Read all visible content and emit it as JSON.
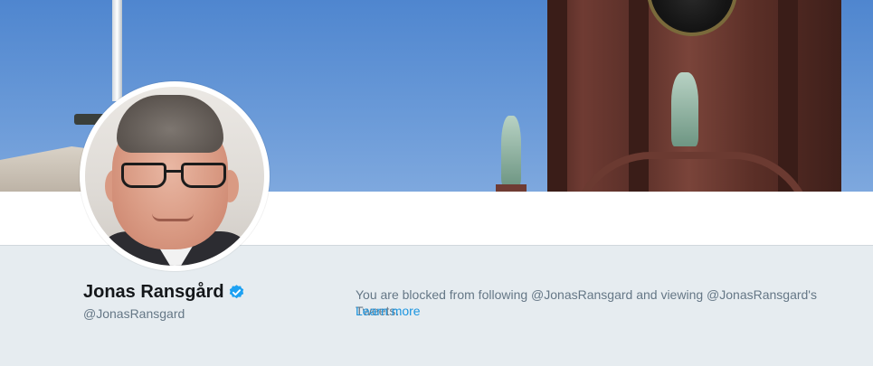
{
  "profile": {
    "display_name": "Jonas Ransgård",
    "handle": "@JonasRansgard",
    "verified_icon": "verified-badge-icon"
  },
  "blocked_notice": {
    "message": "You are blocked from following @JonasRansgard and viewing @JonasRansgard's Tweets.",
    "link_label": "Learn more"
  },
  "colors": {
    "page_background": "#e6ecf0",
    "name": "#14171a",
    "secondary_text": "#657786",
    "link": "#1b95e0",
    "verified": "#1da1f2"
  }
}
